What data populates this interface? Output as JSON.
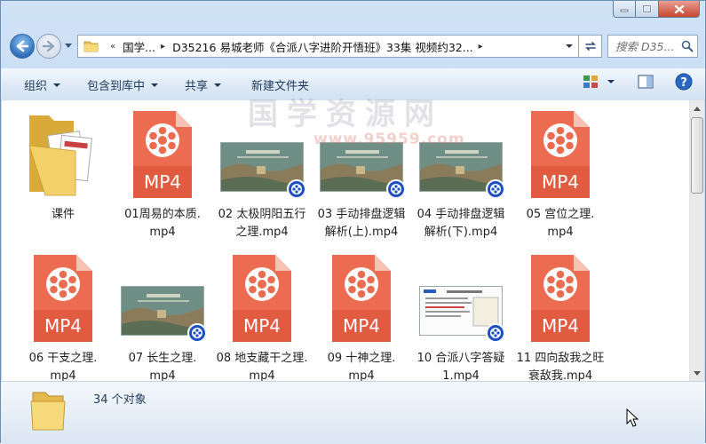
{
  "address": {
    "segments": [
      "国学...",
      "D35216 易城老师《合派八字进阶开悟班》33集 视频约32..."
    ]
  },
  "search": {
    "placeholder": "搜索 D35..."
  },
  "toolbar": {
    "organize": "组织",
    "include_in_library": "包含到库中",
    "share": "共享",
    "new_folder": "新建文件夹"
  },
  "files": [
    {
      "line1": "课件",
      "line2": "",
      "kind": "folder"
    },
    {
      "line1": "01周易的本质.",
      "line2": "mp4",
      "kind": "mp4"
    },
    {
      "line1": "02 太极阴阳五行",
      "line2": "之理.mp4",
      "kind": "video"
    },
    {
      "line1": "03 手动排盘逻辑",
      "line2": "解析(上).mp4",
      "kind": "video"
    },
    {
      "line1": "04 手动排盘逻辑",
      "line2": "解析(下).mp4",
      "kind": "video"
    },
    {
      "line1": "05 宫位之理.",
      "line2": "mp4",
      "kind": "mp4"
    },
    {
      "line1": "06 干支之理.",
      "line2": "mp4",
      "kind": "mp4"
    },
    {
      "line1": "07 长生之理.",
      "line2": "mp4",
      "kind": "video"
    },
    {
      "line1": "08 地支藏干之理.",
      "line2": "mp4",
      "kind": "mp4"
    },
    {
      "line1": "09 十神之理.",
      "line2": "mp4",
      "kind": "mp4"
    },
    {
      "line1": "10 合派八字答疑",
      "line2": "1.mp4",
      "kind": "doc"
    },
    {
      "line1": "11 四向敌我之旺",
      "line2": "衰敌我.mp4",
      "kind": "mp4"
    }
  ],
  "mp4_label": "MP4",
  "watermark": {
    "text": "国学资源网",
    "url": "www.95959.com"
  },
  "status": {
    "count": "34 个对象"
  },
  "colors": {
    "mp4": "#ec6c51",
    "accent": "#1e395b"
  }
}
